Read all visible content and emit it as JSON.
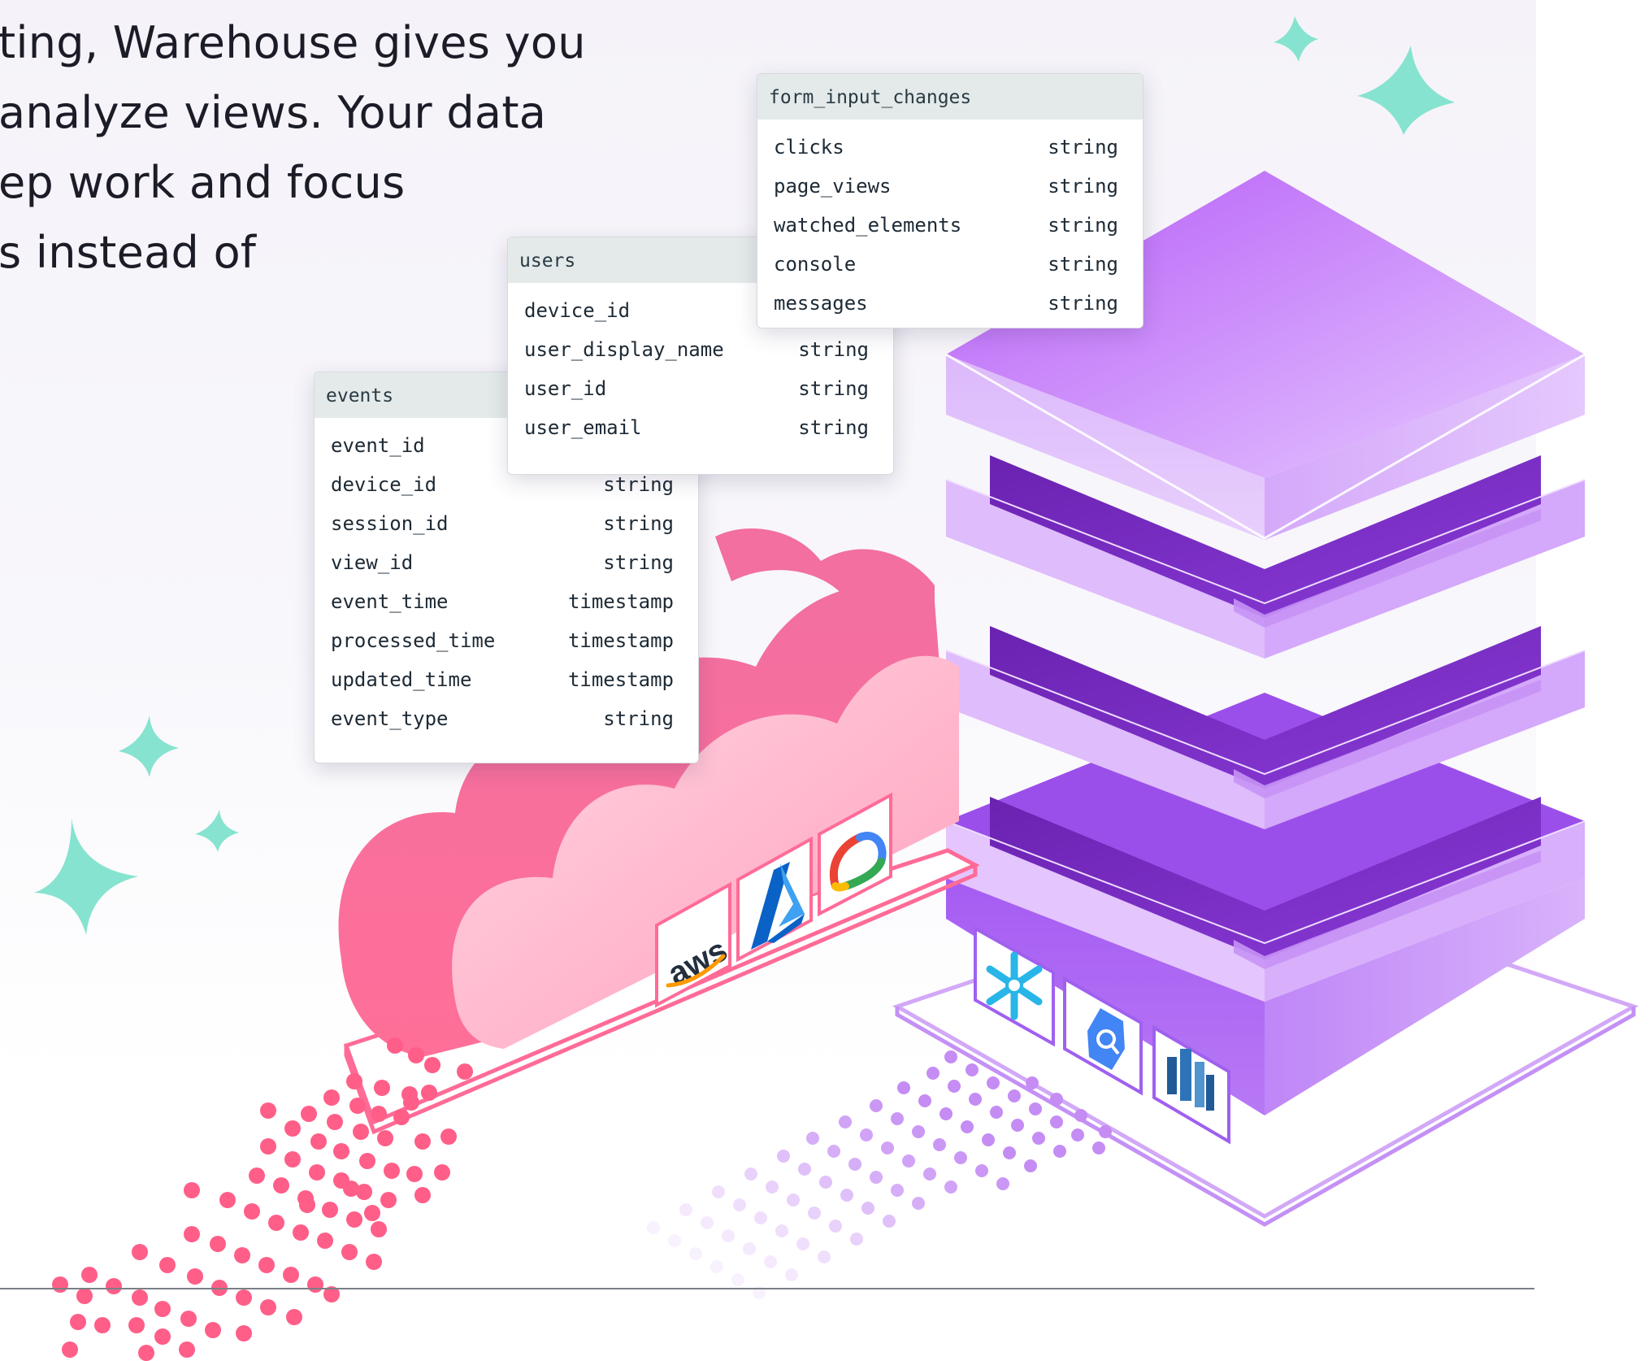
{
  "intro_lines": [
    "ting, Warehouse gives you",
    "analyze views. Your data",
    "ep work and focus",
    "s instead of"
  ],
  "tables": {
    "events": {
      "name": "events",
      "columns": [
        {
          "field": "event_id",
          "type": ""
        },
        {
          "field": "device_id",
          "type": "string"
        },
        {
          "field": "session_id",
          "type": "string"
        },
        {
          "field": "view_id",
          "type": "string"
        },
        {
          "field": "event_time",
          "type": "timestamp"
        },
        {
          "field": "processed_time",
          "type": "timestamp"
        },
        {
          "field": "updated_time",
          "type": "timestamp"
        },
        {
          "field": "event_type",
          "type": "string"
        }
      ]
    },
    "users": {
      "name": "users",
      "columns": [
        {
          "field": "device_id",
          "type": ""
        },
        {
          "field": "user_display_name",
          "type": "string"
        },
        {
          "field": "user_id",
          "type": "string"
        },
        {
          "field": "user_email",
          "type": "string"
        }
      ]
    },
    "form_input_changes": {
      "name": "form_input_changes",
      "columns": [
        {
          "field": "clicks",
          "type": "string"
        },
        {
          "field": "page_views",
          "type": "string"
        },
        {
          "field": "watched_elements",
          "type": "string"
        },
        {
          "field": "console",
          "type": "string"
        },
        {
          "field": "messages",
          "type": "string"
        }
      ]
    }
  },
  "cloud_provider_logos": [
    {
      "icon": "aws-logo",
      "label": "aws"
    },
    {
      "icon": "azure-logo",
      "label": ""
    },
    {
      "icon": "google-cloud-logo",
      "label": ""
    }
  ],
  "warehouse_logos": [
    {
      "icon": "snowflake-logo"
    },
    {
      "icon": "bigquery-logo"
    },
    {
      "icon": "redshift-logo"
    }
  ],
  "colors": {
    "sparkle": "#86e3cf",
    "cloud_pink": "#ff7aa2",
    "warehouse_purple": "#a15af0",
    "table_header": "#e3eae9"
  }
}
